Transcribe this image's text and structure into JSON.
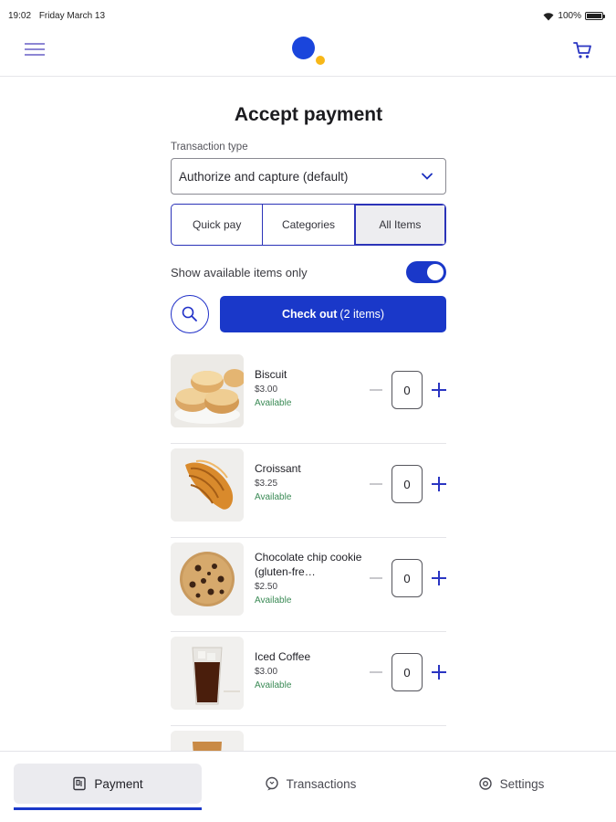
{
  "status_bar": {
    "time": "19:02",
    "date": "Friday March 13",
    "battery": "100%",
    "battery_level": 1.0
  },
  "app_bar": {
    "menu_icon": "menu-icon",
    "logo": "brand-logo",
    "cart_icon": "cart-icon"
  },
  "colors": {
    "primary": "#1a38c9",
    "accent_yellow": "#f7b718",
    "available_green": "#3a8a55"
  },
  "page": {
    "title": "Accept payment"
  },
  "transaction_type": {
    "label": "Transaction type",
    "value": "Authorize and capture (default)"
  },
  "tabs": [
    {
      "label": "Quick pay",
      "active": false
    },
    {
      "label": "Categories",
      "active": false
    },
    {
      "label": "All Items",
      "active": true
    }
  ],
  "filter": {
    "label": "Show available items only",
    "enabled": true
  },
  "checkout": {
    "label": "Check out",
    "count": "(2 items)"
  },
  "items": [
    {
      "name": "Biscuit",
      "price": "$3.00",
      "status": "Available",
      "qty": "0",
      "image": "biscuit"
    },
    {
      "name": "Croissant",
      "price": "$3.25",
      "status": "Available",
      "qty": "0",
      "image": "croissant"
    },
    {
      "name": "Chocolate chip cookie (gluten-fre…",
      "price": "$2.50",
      "status": "Available",
      "qty": "0",
      "image": "cookie"
    },
    {
      "name": "Iced Coffee",
      "price": "$3.00",
      "status": "Available",
      "qty": "0",
      "image": "iced-coffee"
    }
  ],
  "bottom_nav": [
    {
      "label": "Payment",
      "icon": "payment-icon",
      "active": true
    },
    {
      "label": "Transactions",
      "icon": "transactions-icon",
      "active": false
    },
    {
      "label": "Settings",
      "icon": "settings-icon",
      "active": false
    }
  ]
}
